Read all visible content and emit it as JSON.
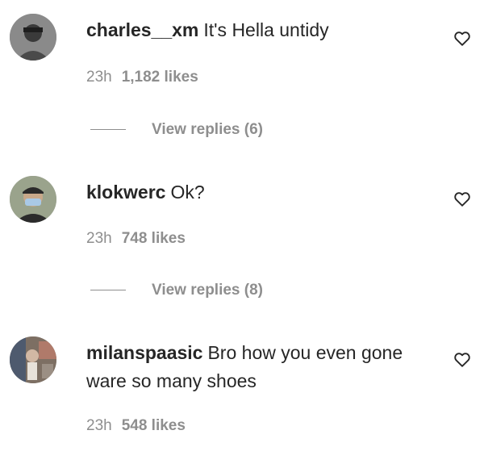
{
  "comments": [
    {
      "username": "charles__xm",
      "text": "It's Hella untidy",
      "time": "23h",
      "likes": "1,182 likes",
      "replies": "View replies (6)",
      "avatar_color": "#8a8a8a",
      "icon": "heart-outline-icon"
    },
    {
      "username": "klokwerc",
      "text": "Ok?",
      "time": "23h",
      "likes": "748 likes",
      "replies": "View replies (8)",
      "avatar_color": "#7c8c74",
      "icon": "heart-outline-icon"
    },
    {
      "username": "milanspaasic",
      "text": "Bro how you even gone ware so many shoes",
      "time": "23h",
      "likes": "548 likes",
      "avatar_color": "#8c7868",
      "icon": "heart-outline-icon"
    }
  ],
  "colors": {
    "text": "#262626",
    "secondary": "#8e8e8e",
    "background": "#ffffff"
  }
}
